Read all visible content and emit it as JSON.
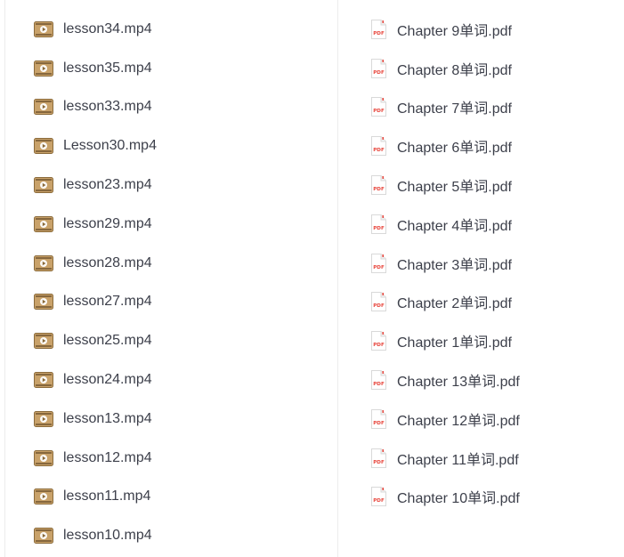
{
  "videos": [
    {
      "name": "lesson34.mp4",
      "icon": "video-thumbnail-icon"
    },
    {
      "name": "lesson35.mp4",
      "icon": "video-thumbnail-icon"
    },
    {
      "name": "lesson33.mp4",
      "icon": "video-thumbnail-icon"
    },
    {
      "name": "Lesson30.mp4",
      "icon": "video-thumbnail-icon"
    },
    {
      "name": "lesson23.mp4",
      "icon": "video-thumbnail-icon"
    },
    {
      "name": "lesson29.mp4",
      "icon": "video-thumbnail-icon"
    },
    {
      "name": "lesson28.mp4",
      "icon": "video-thumbnail-icon"
    },
    {
      "name": "lesson27.mp4",
      "icon": "video-thumbnail-icon"
    },
    {
      "name": "lesson25.mp4",
      "icon": "video-thumbnail-icon"
    },
    {
      "name": "lesson24.mp4",
      "icon": "video-thumbnail-icon"
    },
    {
      "name": "lesson13.mp4",
      "icon": "video-thumbnail-icon"
    },
    {
      "name": "lesson12.mp4",
      "icon": "video-thumbnail-icon"
    },
    {
      "name": "lesson11.mp4",
      "icon": "video-thumbnail-icon"
    },
    {
      "name": "lesson10.mp4",
      "icon": "video-thumbnail-icon"
    }
  ],
  "pdfs": [
    {
      "name": "Chapter 9单词.pdf",
      "icon": "pdf-file-icon"
    },
    {
      "name": "Chapter 8单词.pdf",
      "icon": "pdf-file-icon"
    },
    {
      "name": "Chapter 7单词.pdf",
      "icon": "pdf-file-icon"
    },
    {
      "name": "Chapter 6单词.pdf",
      "icon": "pdf-file-icon"
    },
    {
      "name": "Chapter 5单词.pdf",
      "icon": "pdf-file-icon"
    },
    {
      "name": "Chapter 4单词.pdf",
      "icon": "pdf-file-icon"
    },
    {
      "name": "Chapter 3单词.pdf",
      "icon": "pdf-file-icon"
    },
    {
      "name": "Chapter 2单词.pdf",
      "icon": "pdf-file-icon"
    },
    {
      "name": "Chapter 1单词.pdf",
      "icon": "pdf-file-icon"
    },
    {
      "name": "Chapter 13单词.pdf",
      "icon": "pdf-file-icon"
    },
    {
      "name": "Chapter 12单词.pdf",
      "icon": "pdf-file-icon"
    },
    {
      "name": "Chapter 11单词.pdf",
      "icon": "pdf-file-icon"
    },
    {
      "name": "Chapter 10单词.pdf",
      "icon": "pdf-file-icon"
    }
  ],
  "pdf_badge": "PDF",
  "colors": {
    "text": "#3c3f4a",
    "video_thumb": "#c9a26a",
    "pdf_red": "#e8483f",
    "divider": "#ececec"
  }
}
